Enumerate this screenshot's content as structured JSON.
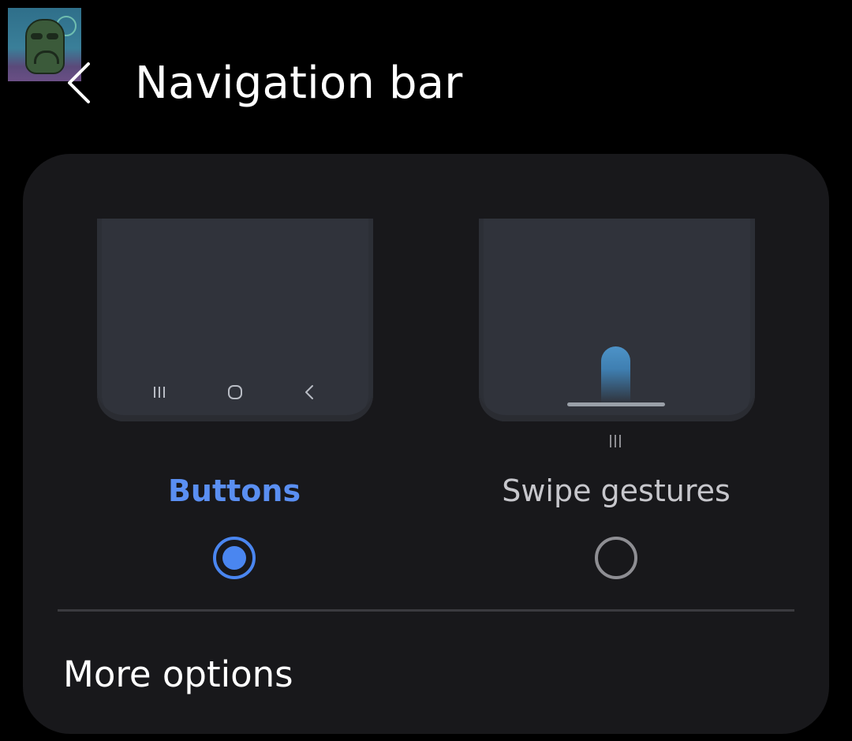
{
  "header": {
    "title": "Navigation bar",
    "back_icon": "chevron-left-icon"
  },
  "avatar": {
    "icon": "profile-picture"
  },
  "options": {
    "buttons": {
      "label": "Buttons",
      "selected": true,
      "nav_icons": [
        "recents-icon",
        "home-icon",
        "back-icon"
      ]
    },
    "swipe": {
      "label": "Swipe gestures",
      "selected": false,
      "hint_icon": "recents-icon"
    }
  },
  "more_options": {
    "label": "More options"
  },
  "colors": {
    "background": "#000000",
    "card": "#18181b",
    "accent": "#4a86f0",
    "preview": "#30333b",
    "unselected_radio": "#8e8e93"
  }
}
